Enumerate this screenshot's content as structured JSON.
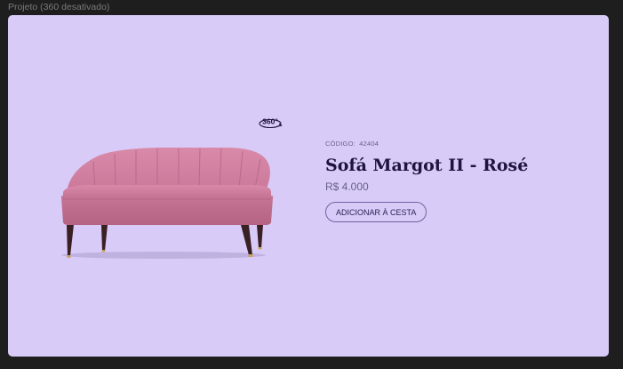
{
  "window": {
    "frame_label": "Projeto (360 desativado)"
  },
  "product": {
    "code_label": "CÓDIGO:",
    "code": "42404",
    "name": "Sofá Margot II - Rosé",
    "price": "R$ 4.000",
    "add_to_cart_label": "ADICIONAR À CESTA",
    "view_360_label": "360°",
    "image_alt": "Sofá Margot II - Rosé"
  },
  "theme": {
    "app_background": "#1e1e1e",
    "frame_background": "#d8cbf7",
    "title_color": "#1f1340",
    "sofa_color": "#cc7c9e"
  }
}
